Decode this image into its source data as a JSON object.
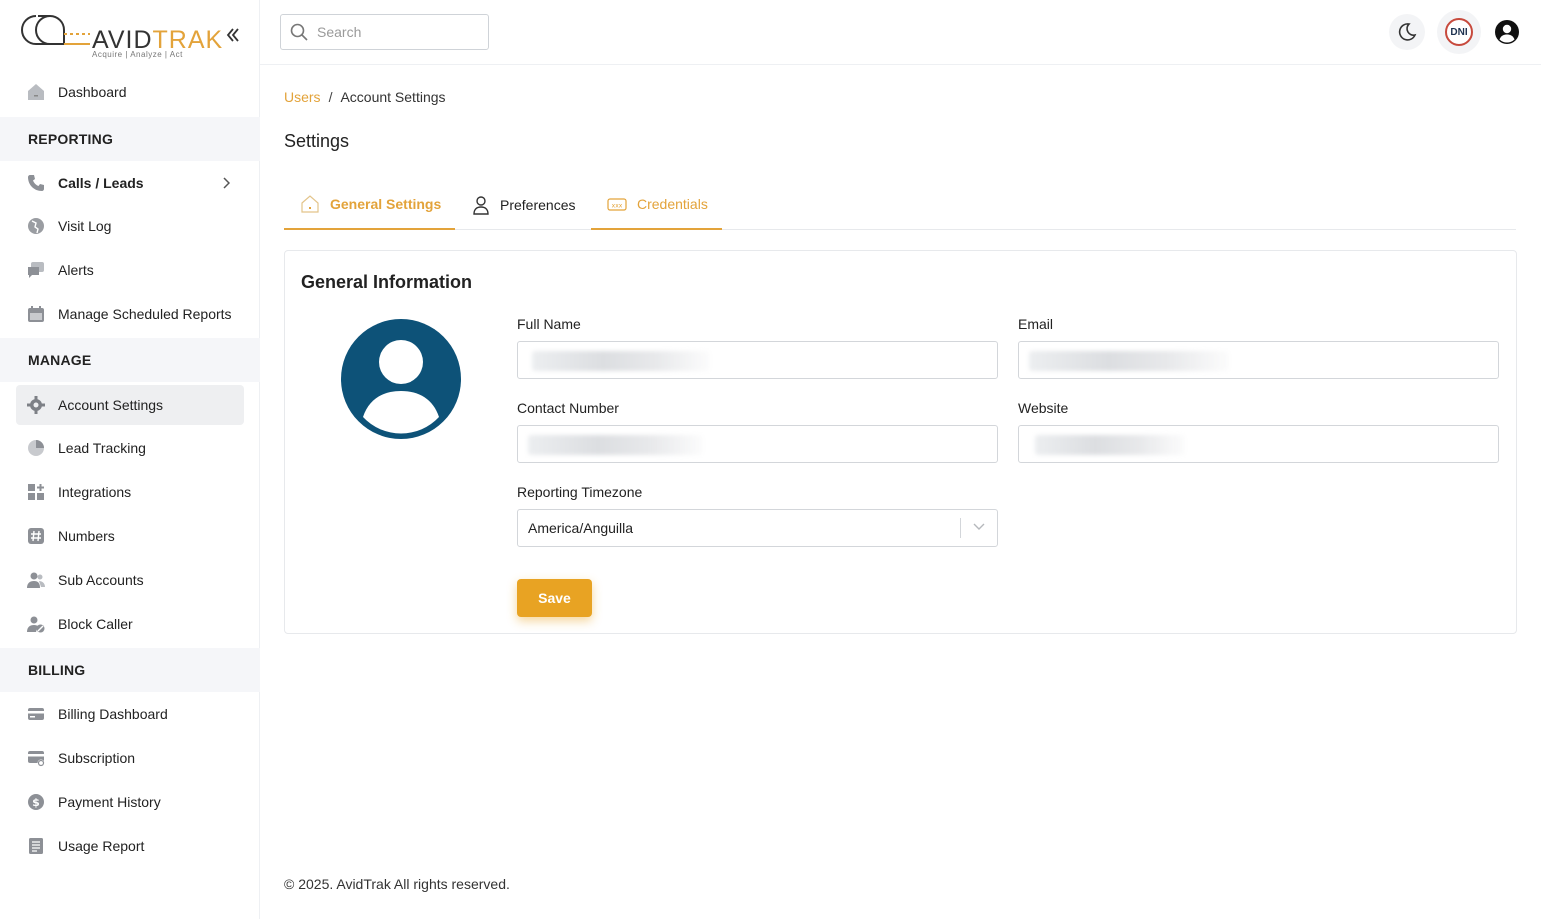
{
  "brand": {
    "logo_avid": "AVID",
    "logo_trak": "TRAK",
    "tagline": "Acquire  |  Analyze  |  Act"
  },
  "sidebar": {
    "dashboard": "Dashboard",
    "sections": {
      "reporting": "REPORTING",
      "manage": "MANAGE",
      "billing": "BILLING"
    },
    "reporting_items": [
      "Calls / Leads",
      "Visit Log",
      "Alerts",
      "Manage Scheduled Reports"
    ],
    "manage_items": [
      "Account Settings",
      "Lead Tracking",
      "Integrations",
      "Numbers",
      "Sub Accounts",
      "Block Caller"
    ],
    "billing_items": [
      "Billing Dashboard",
      "Subscription",
      "Payment History",
      "Usage Report"
    ],
    "active_item": "Account Settings"
  },
  "header": {
    "search_placeholder": "Search",
    "dni_label": "DNI"
  },
  "breadcrumb": {
    "parent": "Users",
    "separator": "/",
    "current": "Account Settings"
  },
  "page": {
    "title": "Settings",
    "tabs": [
      "General Settings",
      "Preferences",
      "Credentials"
    ],
    "active_tab": "General Settings"
  },
  "form": {
    "card_title": "General Information",
    "full_name_label": "Full Name",
    "email_label": "Email",
    "contact_label": "Contact Number",
    "website_label": "Website",
    "timezone_label": "Reporting Timezone",
    "timezone_value": "America/Anguilla",
    "save_label": "Save"
  },
  "colors": {
    "accent": "#e3a33a",
    "save_button": "#e8a323",
    "avatar": "#0d5278"
  },
  "footer": {
    "copyright": "© 2025. AvidTrak All rights reserved."
  }
}
